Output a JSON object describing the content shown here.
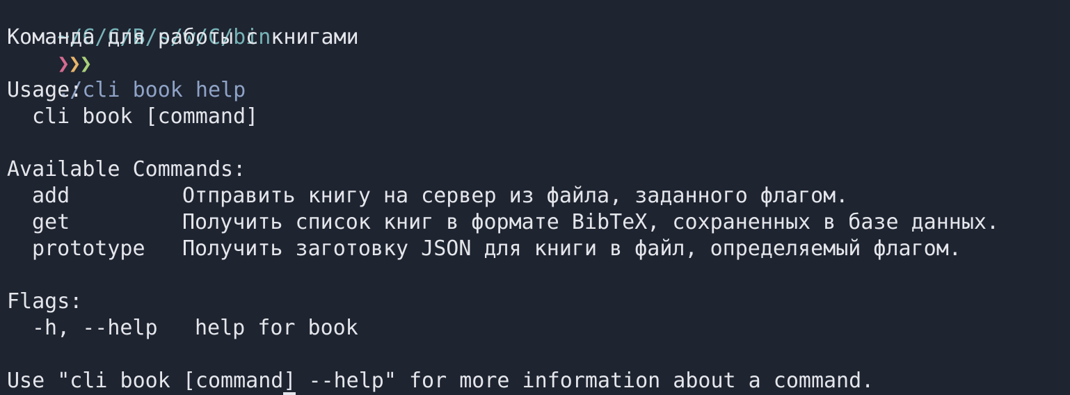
{
  "prompt": {
    "cwd": "~/C/C/B/s/w/C/bin",
    "arrows": [
      "❯",
      "❯",
      "❯"
    ],
    "command": "./cli book help"
  },
  "output": {
    "description": "Команда для работы с книгами",
    "usage_header": "Usage:",
    "usage_line": "cli book [command]",
    "commands_header": "Available Commands:",
    "commands": [
      {
        "name": "add",
        "desc": "Отправить книгу на сервер из файла, заданного флагом."
      },
      {
        "name": "get",
        "desc": "Получить список книг в формате BibTeX, сохраненных в базе данных."
      },
      {
        "name": "prototype",
        "desc": "Получить заготовку JSON для книги в файл, определяемый флагом."
      }
    ],
    "flags_header": "Flags:",
    "flags": [
      {
        "name": "-h, --help",
        "desc": "help for book"
      }
    ],
    "footer": "Use \"cli book [command] --help\" for more information about a command."
  },
  "colors": {
    "background": "#1e2430",
    "text": "#e4e6eb",
    "cwd": "#77b4b8",
    "command": "#8fa3c7"
  }
}
